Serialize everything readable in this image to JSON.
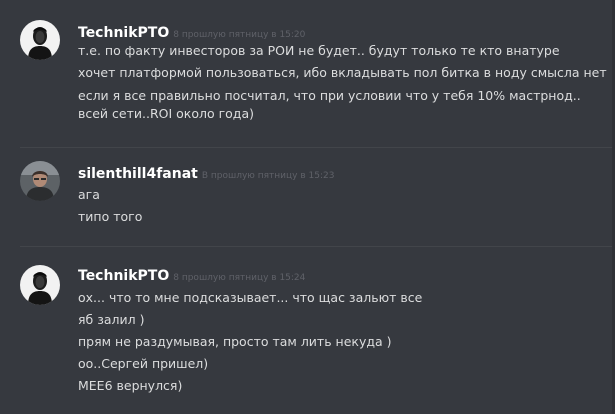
{
  "colors": {
    "background": "#36393f",
    "author": "#ffffff",
    "text": "#dcddde",
    "timestamp": "#5f6168",
    "divider": "#42454a"
  },
  "messages": [
    {
      "author": "TechnikPTO",
      "timestamp": "8 прошлую пятницу в 15:20",
      "avatar_icon": "user-avatar-icon",
      "lines": [
        "т.е. по факту инвесторов за РОИ не будет.. будут только те кто внатуре",
        "хочет платформой пользоваться, ибо вкладывать пол битка в ноду смыслa нет",
        "если я все правильно посчитал, что при условии что у тебя 10% мастрнод..",
        "всей сети..ROI около года)"
      ]
    },
    {
      "author": "silenthill4fanat",
      "timestamp": "В прошлую пятницу в 15:23",
      "avatar_icon": "user-avatar-icon",
      "lines": [
        "ага",
        "типо того"
      ]
    },
    {
      "author": "TechnikPTO",
      "timestamp": "8 прошлую пятницу в 15:24",
      "avatar_icon": "user-avatar-icon",
      "lines": [
        "ох... что то мне подсказывает... что щас зальют все",
        "яб залил )",
        "прям не раздумывая, просто там лить некуда )",
        "оо..Сергей пришел)",
        "MEE6 вернулся)"
      ]
    }
  ]
}
